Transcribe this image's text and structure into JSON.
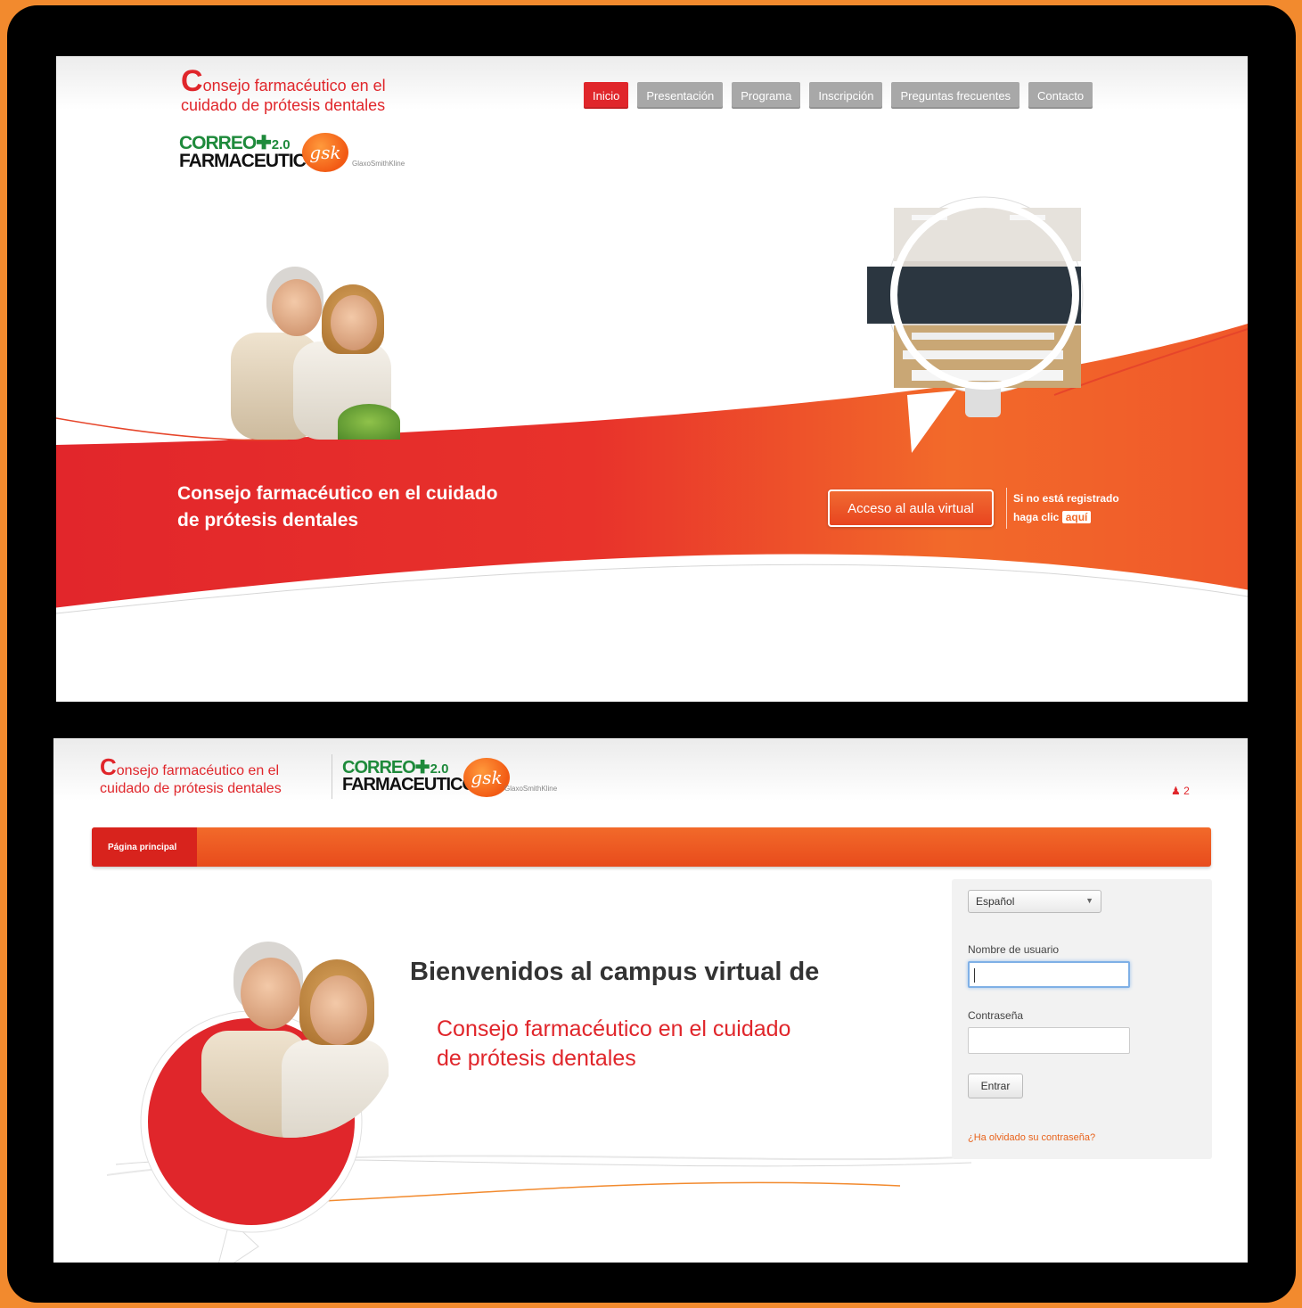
{
  "colors": {
    "brand_red": "#e0262b",
    "orange": "#f26a2a",
    "frame_orange": "#f28a2e",
    "nav_grey": "#a8a8a8"
  },
  "brand": {
    "title_cap": "C",
    "title_line1": "onsejo farmacéutico en el",
    "title_line2": "cuidado de prótesis dentales",
    "correo_line1": "CORREO",
    "correo_line2": "FARMACEUTICO",
    "correo_version": "2.0",
    "gsk": "gsk",
    "gsk_sub": "GlaxoSmithKline"
  },
  "home": {
    "nav": [
      "Inicio",
      "Presentación",
      "Programa",
      "Inscripción",
      "Preguntas frecuentes",
      "Contacto"
    ],
    "banner_line1": "Consejo farmacéutico en el cuidado",
    "banner_line2": "de prótesis dentales",
    "aula_button": "Acceso al aula virtual",
    "register_line1": "Si no está registrado",
    "register_line2": "haga clic",
    "register_link": "aquí"
  },
  "campus": {
    "breadcrumb": "Página principal",
    "user_count": "2",
    "welcome": "Bienvenidos al campus virtual de",
    "course_line1": "Consejo farmacéutico en el cuidado",
    "course_line2": "de prótesis dentales",
    "login": {
      "language": "Español",
      "username_label": "Nombre de usuario",
      "password_label": "Contraseña",
      "submit": "Entrar",
      "forgot": "¿Ha olvidado su contraseña?"
    }
  },
  "icons": [
    "user-icon",
    "dropdown-caret-icon",
    "classroom-photo-icon",
    "couple-photo-icon"
  ]
}
